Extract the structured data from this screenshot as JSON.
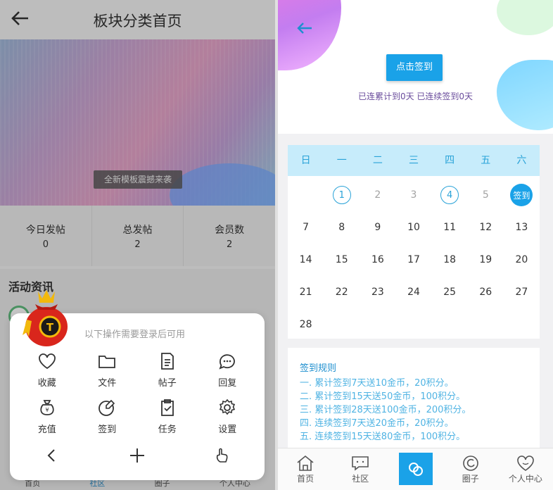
{
  "left": {
    "title": "板块分类首页",
    "banner_caption": "全新模板震撼来袭",
    "stats": [
      {
        "label": "今日发帖",
        "value": "0"
      },
      {
        "label": "总发帖",
        "value": "2"
      },
      {
        "label": "会员数",
        "value": "2"
      }
    ],
    "activity_heading": "活动资讯",
    "sheet": {
      "hint": "以下操作需要登录后可用",
      "items": [
        {
          "label": "收藏",
          "icon": "heart-icon"
        },
        {
          "label": "文件",
          "icon": "folder-icon"
        },
        {
          "label": "帖子",
          "icon": "document-icon"
        },
        {
          "label": "回复",
          "icon": "chat-bubble-icon"
        },
        {
          "label": "充值",
          "icon": "money-bag-icon"
        },
        {
          "label": "签到",
          "icon": "sign-pen-icon"
        },
        {
          "label": "任务",
          "icon": "clipboard-check-icon"
        },
        {
          "label": "设置",
          "icon": "gear-icon"
        }
      ]
    },
    "bottom_nav": [
      "首页",
      "社区",
      "圈子",
      "个人中心"
    ]
  },
  "right": {
    "sign_button": "点击签到",
    "streak_text": "已连累计到0天 已连续签到0天",
    "weekdays": [
      "日",
      "一",
      "二",
      "三",
      "四",
      "五",
      "六"
    ],
    "days": [
      {
        "t": "",
        "s": "empty"
      },
      {
        "t": "1",
        "s": "ring"
      },
      {
        "t": "2",
        "s": "faint"
      },
      {
        "t": "3",
        "s": "faint"
      },
      {
        "t": "4",
        "s": "ring"
      },
      {
        "t": "5",
        "s": "faint"
      },
      {
        "t": "签到",
        "s": "done"
      },
      {
        "t": "7",
        "s": "n"
      },
      {
        "t": "8",
        "s": "n"
      },
      {
        "t": "9",
        "s": "n"
      },
      {
        "t": "10",
        "s": "n"
      },
      {
        "t": "11",
        "s": "n"
      },
      {
        "t": "12",
        "s": "n"
      },
      {
        "t": "13",
        "s": "n"
      },
      {
        "t": "14",
        "s": "n"
      },
      {
        "t": "15",
        "s": "n"
      },
      {
        "t": "16",
        "s": "n"
      },
      {
        "t": "17",
        "s": "n"
      },
      {
        "t": "18",
        "s": "n"
      },
      {
        "t": "19",
        "s": "n"
      },
      {
        "t": "20",
        "s": "n"
      },
      {
        "t": "21",
        "s": "n"
      },
      {
        "t": "22",
        "s": "n"
      },
      {
        "t": "23",
        "s": "n"
      },
      {
        "t": "24",
        "s": "n"
      },
      {
        "t": "25",
        "s": "n"
      },
      {
        "t": "26",
        "s": "n"
      },
      {
        "t": "27",
        "s": "n"
      },
      {
        "t": "28",
        "s": "n"
      }
    ],
    "rules_title": "签到规则",
    "rules": [
      "一. 累计签到7天送10金币，20积分。",
      "二. 累计签到15天送50金币，100积分。",
      "三. 累计签到28天送100金币，200积分。",
      "四. 连续签到7天送20金币，20积分。",
      "五. 连续签到15天送80金币，100积分。"
    ],
    "nav": [
      {
        "label": "首页",
        "icon": "home-icon"
      },
      {
        "label": "社区",
        "icon": "community-icon"
      },
      {
        "label": "",
        "icon": "circle-link-icon"
      },
      {
        "label": "圈子",
        "icon": "refresh-circle-icon"
      },
      {
        "label": "个人中心",
        "icon": "heart-face-icon"
      }
    ]
  },
  "colors": {
    "accent": "#1aa2e8",
    "calendar_header": "#c7ecfb",
    "rule_text": "#4fb3e3",
    "streak_text": "#6a4c9c"
  }
}
